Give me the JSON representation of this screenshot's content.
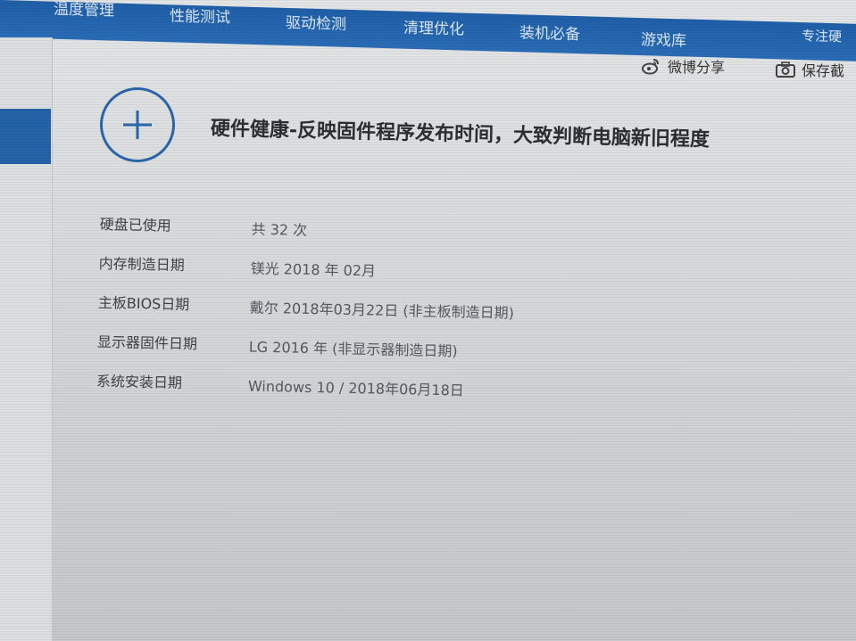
{
  "nav": {
    "items": [
      "温度管理",
      "性能测试",
      "驱动检测",
      "清理优化",
      "装机必备",
      "游戏库",
      "专注硬"
    ]
  },
  "toolbar": {
    "weibo_share": "微博分享",
    "save_screenshot": "保存截"
  },
  "header": {
    "title": "硬件健康-反映固件程序发布时间，大致判断电脑新旧程度"
  },
  "info": [
    {
      "label": "硬盘已使用",
      "value": "共 32 次"
    },
    {
      "label": "内存制造日期",
      "value": "镁光 2018 年 02月"
    },
    {
      "label": "主板BIOS日期",
      "value": "戴尔 2018年03月22日 (非主板制造日期)"
    },
    {
      "label": "显示器固件日期",
      "value": "LG 2016 年 (非显示器制造日期)"
    },
    {
      "label": "系统安装日期",
      "value": "Windows 10 / 2018年06月18日"
    }
  ],
  "colors": {
    "nav_bg": "#2566ad",
    "accent": "#2a66aa",
    "sidebar_active": "#2463a8"
  },
  "icons": {
    "add": "plus-circle-icon",
    "weibo": "weibo-icon",
    "camera": "camera-icon"
  }
}
